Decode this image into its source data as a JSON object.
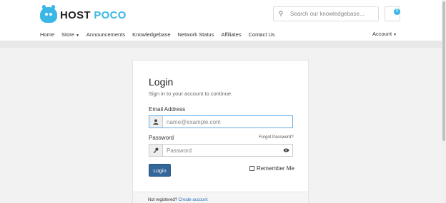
{
  "brand": {
    "name_part1": "HOST",
    "name_part2": "POCO",
    "accent": "#39b7e6"
  },
  "header": {
    "search": {
      "placeholder": "Search our knowledgebase...",
      "icon": "search-icon"
    },
    "cart": {
      "count": "0",
      "icon": "cart-icon"
    }
  },
  "nav": {
    "items": [
      {
        "label": "Home"
      },
      {
        "label": "Store",
        "dropdown": true
      },
      {
        "label": "Announcements"
      },
      {
        "label": "Knowledgebase"
      },
      {
        "label": "Network Status"
      },
      {
        "label": "Affiliates"
      },
      {
        "label": "Contact Us"
      }
    ],
    "account": {
      "label": "Account",
      "dropdown": true
    }
  },
  "login": {
    "title": "Login",
    "subtitle": "Sign in to your account to continue.",
    "email": {
      "label": "Email Address",
      "placeholder": "name@example.com",
      "value": "",
      "icon": "user-icon"
    },
    "password": {
      "label": "Password",
      "placeholder": "Password",
      "value": "",
      "icon": "key-icon",
      "toggle_icon": "eye-icon"
    },
    "forgot_link": "Forgot Password?",
    "submit_label": "Login",
    "remember": {
      "label": "Remember Me",
      "checked": false
    },
    "footer": {
      "text": "Not registered?",
      "link": "Create account"
    }
  },
  "colors": {
    "primary_button": "#336699",
    "focus_border": "#66afe9",
    "link": "#2a6ebb"
  }
}
